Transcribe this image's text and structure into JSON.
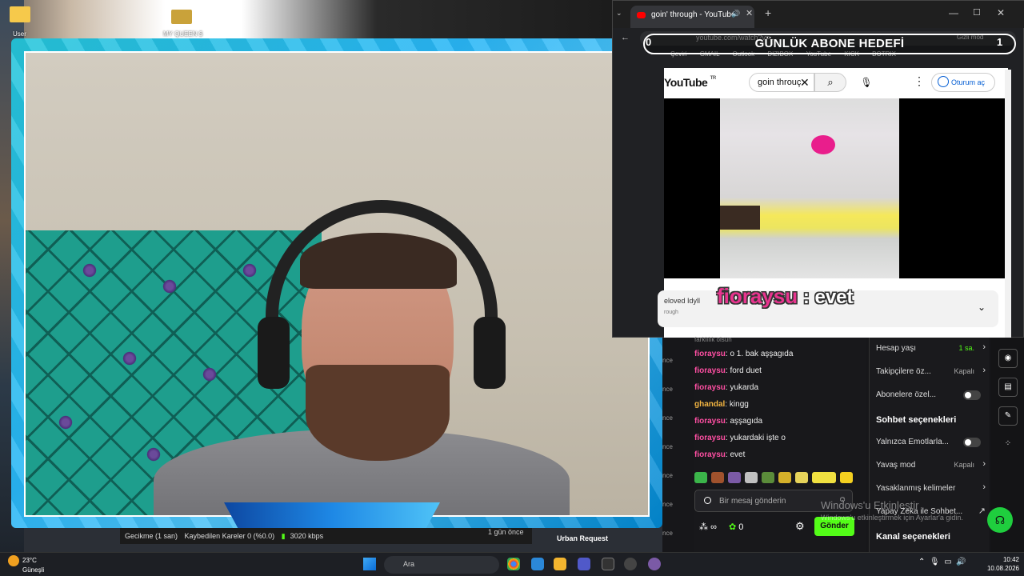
{
  "desktop": {
    "icons": [
      "User",
      "MY QUEEN $"
    ]
  },
  "overlay": {
    "goal_title": "GÜNLÜK ABONE HEDEFİ",
    "goal_left": "0",
    "goal_right": "1",
    "frame_counter": "0",
    "chat_user": "fioraysu",
    "chat_sep": " : ",
    "chat_text": "evet"
  },
  "browser": {
    "tab_title": "goin' through - YouTube",
    "address": "youtube.com/watch?v=...",
    "incognito": "Gizli mod",
    "bookmarks": [
      "Çeviri",
      "GMAIL",
      "Outlook",
      "DIZIBOX",
      "YouTube",
      "KICK",
      "BOTRIX"
    ],
    "youtube": {
      "logo": "YouTube",
      "logo_country": "TR",
      "search_value": "goin throuç",
      "signin": "Oturum aç",
      "video_title": "eloved Idyll",
      "video_sub": "rough"
    }
  },
  "chat": {
    "truncated_top": "farklılık olsun",
    "messages": [
      {
        "user": "fioraysu",
        "color": "#ff4fa3",
        "text": "o 1. bak aşşagıda"
      },
      {
        "user": "fioraysu",
        "color": "#ff4fa3",
        "text": "ford duet"
      },
      {
        "user": "fioraysu",
        "color": "#ff4fa3",
        "text": "yukarda"
      },
      {
        "user": "ghandal",
        "color": "#f2b441",
        "text": "kingg"
      },
      {
        "user": "fioraysu",
        "color": "#ff4fa3",
        "text": "aşşagıda"
      },
      {
        "user": "fioraysu",
        "color": "#ff4fa3",
        "text": "yukardaki işte o"
      },
      {
        "user": "fioraysu",
        "color": "#ff4fa3",
        "text": "evet"
      }
    ],
    "time_labels": [
      "nce",
      "nce",
      "nce",
      "nce",
      "nce",
      "nce",
      "nce"
    ],
    "input_placeholder": "Bir mesaj gönderin",
    "send_label": "Gönder",
    "points": "0",
    "infinity": "∞"
  },
  "settings": {
    "rows_top": [
      {
        "label": "Hesap yaşı",
        "value": "1 sa."
      },
      {
        "label": "Takipçilere öz...",
        "value": "Kapalı"
      },
      {
        "label": "Abonelere özel...",
        "toggle": true
      }
    ],
    "section_chat": "Sohbet seçenekleri",
    "rows_chat": [
      {
        "label": "Yalnızca Emotlarla...",
        "toggle": true
      },
      {
        "label": "Yavaş mod",
        "value": "Kapalı"
      },
      {
        "label": "Yasaklanmış kelimeler",
        "value": ""
      },
      {
        "label": "Yapay Zeka ile Sohbet...",
        "value": ""
      }
    ],
    "section_channel": "Kanal seçenekleri"
  },
  "windows_activation": {
    "line1": "Windows'u Etkinleştir",
    "line2": "Windows'u etkinleştirmek için Ayarlar'a gidin."
  },
  "stats": {
    "latency": "Gecikme (1 san)",
    "dropped": "Kaybedilen Kareler 0 (%0.0)",
    "kbps": "3020 kbps",
    "since": "1 gün önce",
    "urban": "Urban Request"
  },
  "taskbar": {
    "weather_temp": "23°C",
    "weather_desc": "Güneşli",
    "search": "Ara",
    "time": "10:42",
    "date": "10.08.2026"
  }
}
